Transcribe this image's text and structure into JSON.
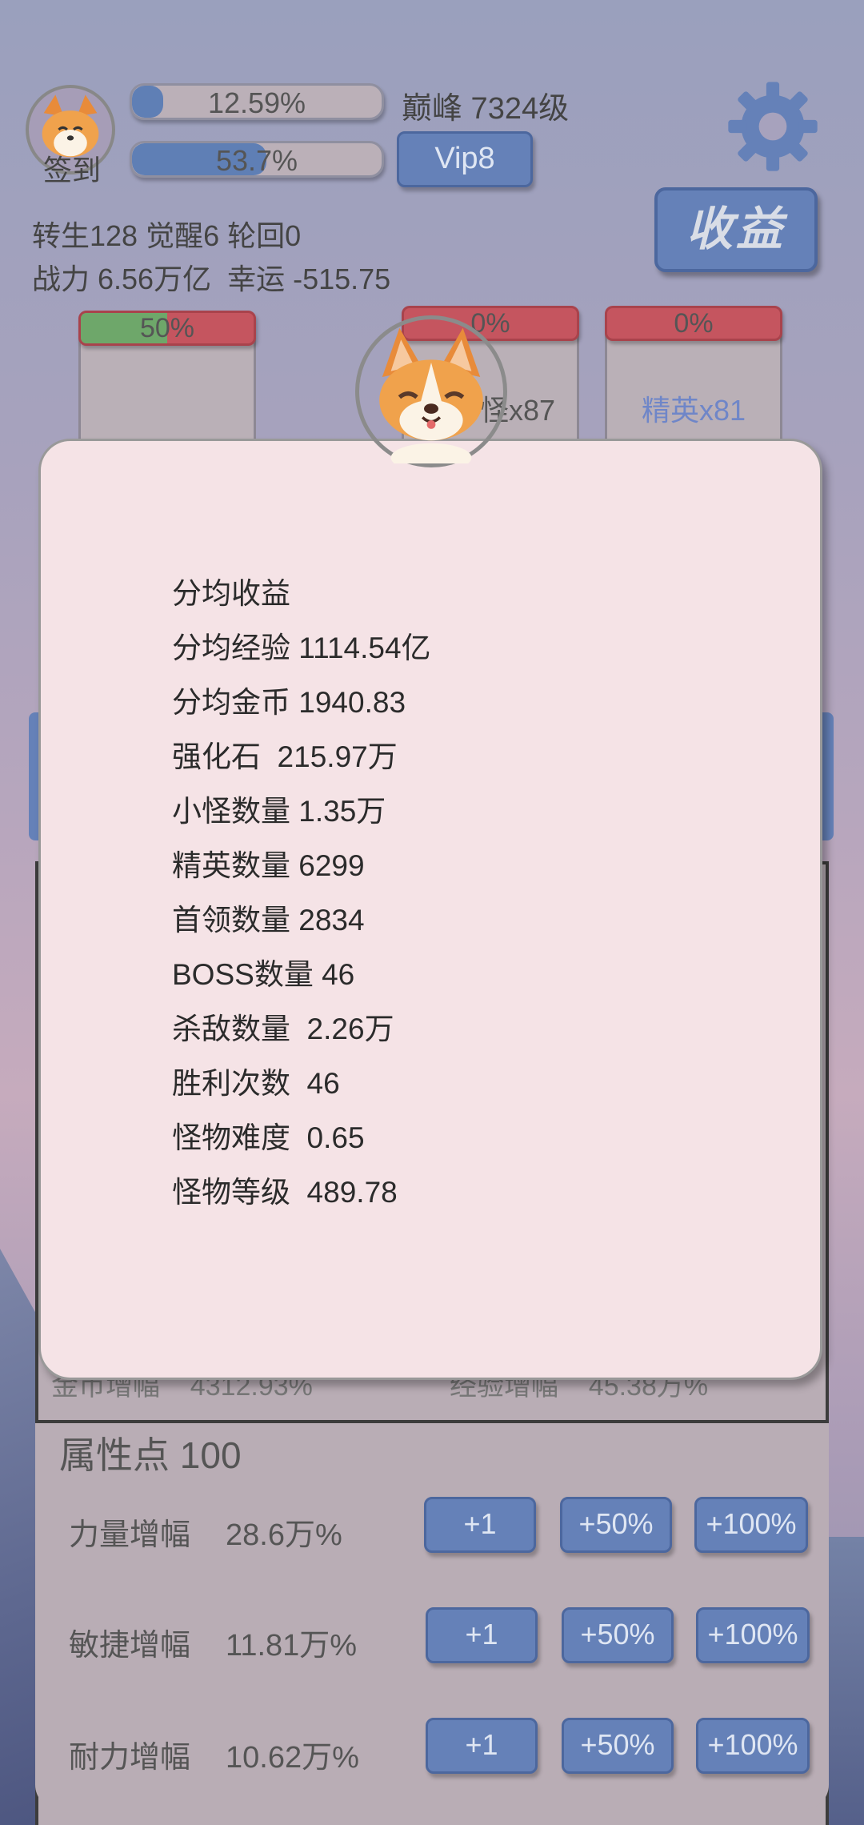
{
  "header": {
    "signin_label": "签到",
    "exp_bar": {
      "label": "12.59%",
      "progress": 0.1259
    },
    "second_bar": {
      "label": "53.7%",
      "progress": 0.537
    },
    "level_text": "巅峰 7324级",
    "vip_label": "Vip8",
    "income_label": "收益",
    "stats_line1": "转生128 觉醒6 轮回0",
    "stats_line2": "战力 6.56万亿  幸运 -515.75"
  },
  "cards": [
    {
      "hp_label": "50%",
      "hp": 0.5,
      "name": ""
    },
    {
      "hp_label": "0%",
      "hp": 0.0,
      "name": "怪x87"
    },
    {
      "hp_label": "0%",
      "hp": 0.0,
      "name": "精英x81"
    }
  ],
  "popup": {
    "lines": [
      "分均收益",
      "分均经验 1114.54亿",
      "分均金币 1940.83",
      "强化石  215.97万",
      "小怪数量 1.35万",
      "精英数量 6299",
      "首领数量 2834",
      "BOSS数量 46",
      "杀敌数量  2.26万",
      "胜利次数  46",
      "怪物难度  0.65",
      "怪物等级  489.78"
    ]
  },
  "hidden_stats": {
    "gold_boost": "金币增幅    4312.93%",
    "exp_boost": "经验增幅    45.38万%"
  },
  "attributes": {
    "title": "属性点 100",
    "rows": [
      {
        "name": "力量增幅",
        "value": "28.6万%"
      },
      {
        "name": "敏捷增幅",
        "value": "11.81万%"
      },
      {
        "name": "耐力增幅",
        "value": "10.62万%"
      }
    ],
    "btn_plus1": "+1",
    "btn_plus50": "+50%",
    "btn_plus100": "+100%"
  },
  "colors": {
    "accent_blue": "#6581b8",
    "hp_red": "#c5555f",
    "hp_green": "#6ea76a",
    "popup_bg": "#f5e3e6"
  },
  "icons": [
    "corgi-avatar",
    "gear-icon"
  ]
}
